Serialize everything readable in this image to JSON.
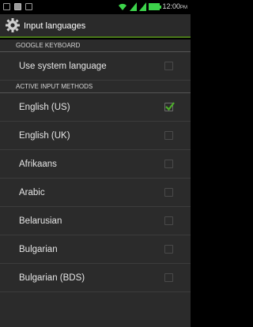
{
  "statusbar": {
    "time": "12:00",
    "ampm": "PM"
  },
  "header": {
    "title": "Input languages"
  },
  "sections": {
    "google": "GOOGLE KEYBOARD",
    "active": "ACTIVE INPUT METHODS"
  },
  "system_language": {
    "label": "Use system language",
    "checked": false
  },
  "languages": [
    {
      "label": "English (US)",
      "checked": true
    },
    {
      "label": "English (UK)",
      "checked": false
    },
    {
      "label": "Afrikaans",
      "checked": false
    },
    {
      "label": "Arabic",
      "checked": false
    },
    {
      "label": "Belarusian",
      "checked": false
    },
    {
      "label": "Bulgarian",
      "checked": false
    },
    {
      "label": "Bulgarian (BDS)",
      "checked": false
    }
  ],
  "colors": {
    "accent": "#4CAF28",
    "wifi": "#3cd34a"
  }
}
